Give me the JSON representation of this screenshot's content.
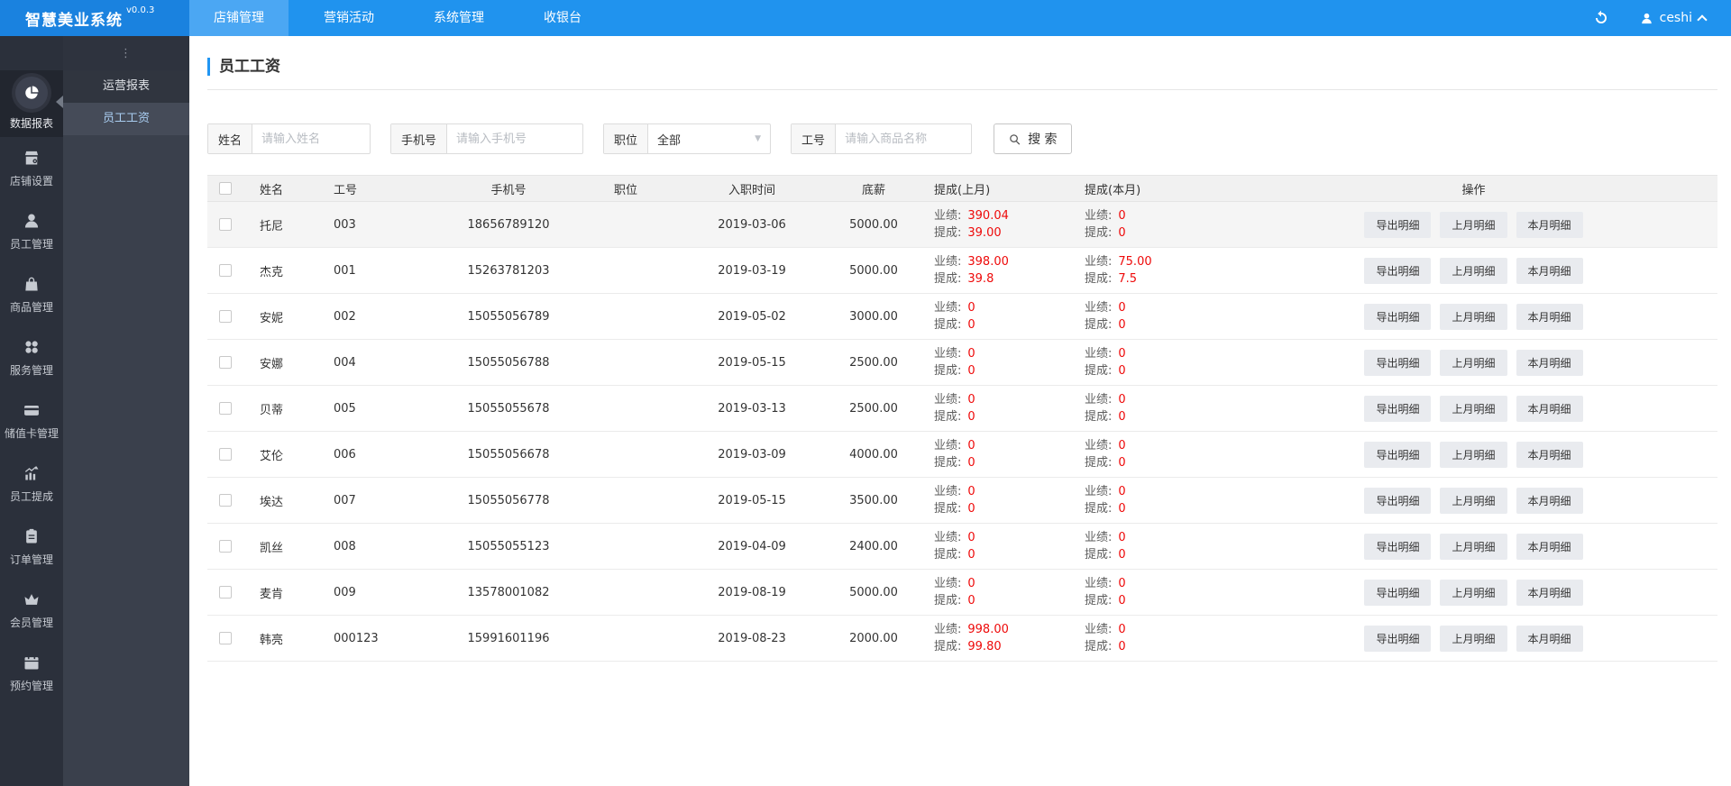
{
  "app": {
    "title": "智慧美业系统",
    "version": "v0.0.3"
  },
  "topnav": {
    "tabs": [
      {
        "label": "店铺管理",
        "active": true
      },
      {
        "label": "营销活动",
        "active": false
      },
      {
        "label": "系统管理",
        "active": false
      },
      {
        "label": "收银台",
        "active": false
      }
    ],
    "refresh_icon": "refresh-icon",
    "user": {
      "icon": "user-icon",
      "name": "ceshi",
      "dropdown_icon": "chevron-up-icon"
    }
  },
  "sidebar": {
    "items": [
      {
        "label": "数据报表",
        "icon": "pie-chart-icon",
        "active": true
      },
      {
        "label": "店铺设置",
        "icon": "storefront-gear-icon",
        "active": false
      },
      {
        "label": "员工管理",
        "icon": "person-icon",
        "active": false
      },
      {
        "label": "商品管理",
        "icon": "shopping-bag-icon",
        "active": false
      },
      {
        "label": "服务管理",
        "icon": "services-grid-icon",
        "active": false
      },
      {
        "label": "储值卡管理",
        "icon": "stored-card-icon",
        "active": false
      },
      {
        "label": "员工提成",
        "icon": "trend-chart-icon",
        "active": false
      },
      {
        "label": "订单管理",
        "icon": "order-clipboard-icon",
        "active": false
      },
      {
        "label": "会员管理",
        "icon": "crown-icon",
        "active": false
      },
      {
        "label": "预约管理",
        "icon": "calendar-icon",
        "active": false
      }
    ]
  },
  "submenu": {
    "collapse_icon": "⋮",
    "items": [
      {
        "label": "运营报表",
        "active": false
      },
      {
        "label": "员工工资",
        "active": true
      }
    ]
  },
  "page": {
    "title": "员工工资"
  },
  "search": {
    "fields": [
      {
        "label": "姓名",
        "type": "input",
        "placeholder": "请输入姓名",
        "value": ""
      },
      {
        "label": "手机号",
        "type": "input",
        "placeholder": "请输入手机号",
        "value": ""
      },
      {
        "label": "职位",
        "type": "select",
        "value": "全部"
      },
      {
        "label": "工号",
        "type": "input",
        "placeholder": "请输入商品名称",
        "value": ""
      }
    ],
    "button": "搜 索",
    "button_icon": "magnifier-icon"
  },
  "table": {
    "columns": [
      "姓名",
      "工号",
      "手机号",
      "职位",
      "入职时间",
      "底薪",
      "提成(上月)",
      "提成(本月)",
      "操作"
    ],
    "commission_labels": {
      "performance": "业绩:",
      "commission": "提成:"
    },
    "action_buttons": [
      "导出明细",
      "上月明细",
      "本月明细"
    ],
    "rows": [
      {
        "name": "托尼",
        "id": "003",
        "phone": "18656789120",
        "position": "",
        "hire_date": "2019-03-06",
        "base_salary": "5000.00",
        "last_month": {
          "performance": "390.04",
          "commission": "39.00"
        },
        "this_month": {
          "performance": "0",
          "commission": "0"
        }
      },
      {
        "name": "杰克",
        "id": "001",
        "phone": "15263781203",
        "position": "",
        "hire_date": "2019-03-19",
        "base_salary": "5000.00",
        "last_month": {
          "performance": "398.00",
          "commission": "39.8"
        },
        "this_month": {
          "performance": "75.00",
          "commission": "7.5"
        }
      },
      {
        "name": "安妮",
        "id": "002",
        "phone": "15055056789",
        "position": "",
        "hire_date": "2019-05-02",
        "base_salary": "3000.00",
        "last_month": {
          "performance": "0",
          "commission": "0"
        },
        "this_month": {
          "performance": "0",
          "commission": "0"
        }
      },
      {
        "name": "安娜",
        "id": "004",
        "phone": "15055056788",
        "position": "",
        "hire_date": "2019-05-15",
        "base_salary": "2500.00",
        "last_month": {
          "performance": "0",
          "commission": "0"
        },
        "this_month": {
          "performance": "0",
          "commission": "0"
        }
      },
      {
        "name": "贝蒂",
        "id": "005",
        "phone": "15055055678",
        "position": "",
        "hire_date": "2019-03-13",
        "base_salary": "2500.00",
        "last_month": {
          "performance": "0",
          "commission": "0"
        },
        "this_month": {
          "performance": "0",
          "commission": "0"
        }
      },
      {
        "name": "艾伦",
        "id": "006",
        "phone": "15055056678",
        "position": "",
        "hire_date": "2019-03-09",
        "base_salary": "4000.00",
        "last_month": {
          "performance": "0",
          "commission": "0"
        },
        "this_month": {
          "performance": "0",
          "commission": "0"
        }
      },
      {
        "name": "埃达",
        "id": "007",
        "phone": "15055056778",
        "position": "",
        "hire_date": "2019-05-15",
        "base_salary": "3500.00",
        "last_month": {
          "performance": "0",
          "commission": "0"
        },
        "this_month": {
          "performance": "0",
          "commission": "0"
        }
      },
      {
        "name": "凯丝",
        "id": "008",
        "phone": "15055055123",
        "position": "",
        "hire_date": "2019-04-09",
        "base_salary": "2400.00",
        "last_month": {
          "performance": "0",
          "commission": "0"
        },
        "this_month": {
          "performance": "0",
          "commission": "0"
        }
      },
      {
        "name": "麦肯",
        "id": "009",
        "phone": "13578001082",
        "position": "",
        "hire_date": "2019-08-19",
        "base_salary": "5000.00",
        "last_month": {
          "performance": "0",
          "commission": "0"
        },
        "this_month": {
          "performance": "0",
          "commission": "0"
        }
      },
      {
        "name": "韩亮",
        "id": "000123",
        "phone": "15991601196",
        "position": "",
        "hire_date": "2019-08-23",
        "base_salary": "2000.00",
        "last_month": {
          "performance": "998.00",
          "commission": "99.80"
        },
        "this_month": {
          "performance": "0",
          "commission": "0"
        }
      }
    ]
  },
  "colors": {
    "accent": "#2196f3",
    "topbar": "#2093ee",
    "value_red": "#ee0a0a",
    "sidebar_dark": "#2b303b"
  }
}
